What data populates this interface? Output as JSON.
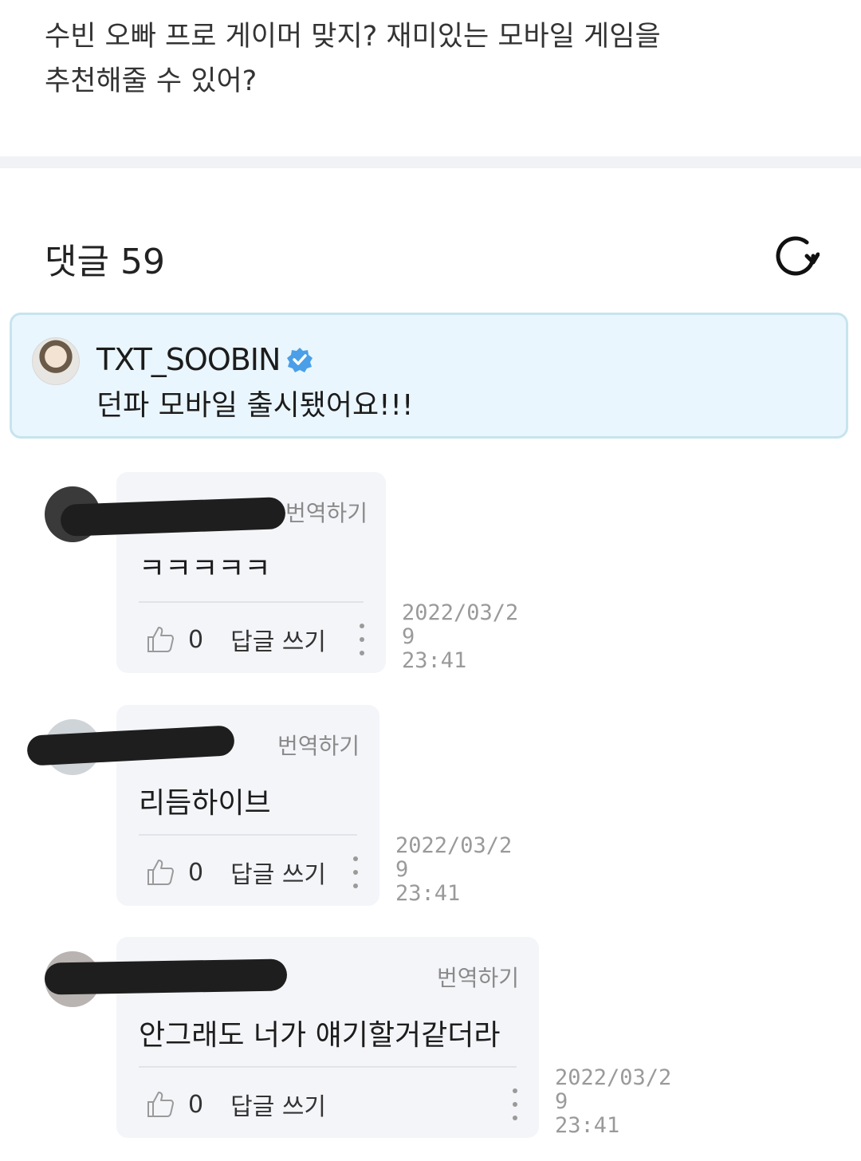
{
  "post": {
    "question": "수빈 오빠 프로 게이머 맞지? 재미있는 모바일 게임을\n추천해줄 수 있어?"
  },
  "comments_section": {
    "header": "댓글 59",
    "refresh_icon": "refresh-icon"
  },
  "pinned_reply": {
    "username": "TXT_SOOBIN",
    "verified_icon": "verified-badge-icon",
    "text": "던파 모바일 출시됐어요!!!",
    "accent_color": "#4a9fe8",
    "background_color": "#eaf6fd"
  },
  "comments": [
    {
      "text": "ㅋㅋㅋㅋㅋ",
      "translate_label": "번역하기",
      "likes": "0",
      "reply_label": "답글 쓰기",
      "date": "2022/03/2\n9\n23:41"
    },
    {
      "text": "리듬하이브",
      "translate_label": "번역하기",
      "likes": "0",
      "reply_label": "답글 쓰기",
      "date": "2022/03/2\n9\n23:41"
    },
    {
      "text": "안그래도 너가 얘기할거같더라",
      "translate_label": "번역하기",
      "likes": "0",
      "reply_label": "답글 쓰기",
      "date": "2022/03/2\n9\n23:41"
    }
  ]
}
